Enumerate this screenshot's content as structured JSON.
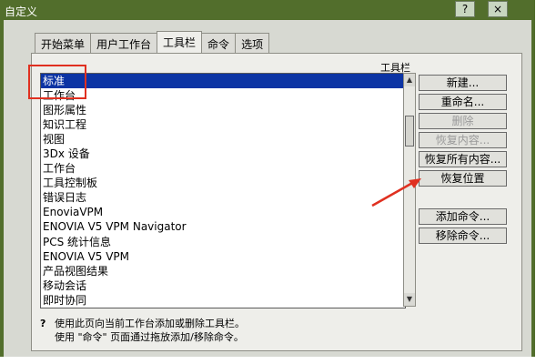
{
  "window": {
    "title": "自定义",
    "help_symbol": "?",
    "close_symbol": "×"
  },
  "tabs": [
    {
      "label": "开始菜单",
      "active": false
    },
    {
      "label": "用户工作台",
      "active": false
    },
    {
      "label": "工具栏",
      "active": true
    },
    {
      "label": "命令",
      "active": false
    },
    {
      "label": "选项",
      "active": false
    }
  ],
  "toolbar_list": {
    "header": "工具栏",
    "items": [
      "标准",
      "工作台",
      "图形属性",
      "知识工程",
      "视图",
      "3Dx 设备",
      "工作台",
      "工具控制板",
      "错误日志",
      "EnoviaVPM",
      "ENOVIA V5 VPM Navigator",
      "PCS 统计信息",
      "ENOVIA V5 VPM",
      "产品视图结果",
      "移动会话",
      "即时协同"
    ],
    "selected_index": 0
  },
  "buttons": {
    "new": "新建...",
    "rename": "重命名...",
    "delete": "删除",
    "restore_contents": "恢复内容...",
    "restore_all_contents": "恢复所有内容...",
    "restore_position": "恢复位置",
    "add_commands": "添加命令...",
    "remove_commands": "移除命令..."
  },
  "help": {
    "icon": "?",
    "line1": "使用此页向当前工作台添加或删除工具栏。",
    "line2": "使用 \"命令\" 页面通过拖放添加/移除命令。"
  },
  "colors": {
    "titlebar": "#526e2c",
    "selection": "#0c34a4",
    "highlight_annotation": "#e03020"
  }
}
